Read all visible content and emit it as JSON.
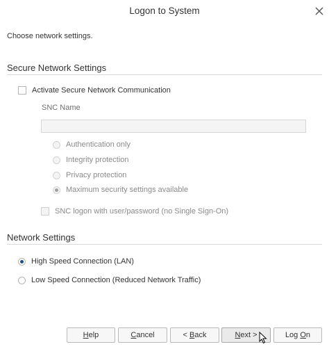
{
  "window": {
    "title": "Logon to System",
    "close_icon": "close-icon"
  },
  "intro_text": "Choose network settings.",
  "secure_network": {
    "section_title": "Secure Network Settings",
    "activate_snc": {
      "label": "Activate Secure Network Communication",
      "checked": false
    },
    "snc_name_label": "SNC Name",
    "snc_name_value": "",
    "protection_options": [
      {
        "label": "Authentication only",
        "selected": false
      },
      {
        "label": "Integrity protection",
        "selected": false
      },
      {
        "label": "Privacy protection",
        "selected": false
      },
      {
        "label": "Maximum security settings available",
        "selected": true
      }
    ],
    "snc_logon_password": {
      "label": "SNC logon with user/password (no Single Sign-On)",
      "checked": false
    }
  },
  "network_settings": {
    "section_title": "Network Settings",
    "options": [
      {
        "label": "High Speed Connection (LAN)",
        "selected": true
      },
      {
        "label": "Low Speed Connection (Reduced Network Traffic)",
        "selected": false
      }
    ]
  },
  "buttons": {
    "help": {
      "mnemonic": "H",
      "rest": "elp"
    },
    "cancel": {
      "mnemonic": "C",
      "rest": "ancel"
    },
    "back": {
      "pre": "< ",
      "mnemonic": "B",
      "rest": "ack"
    },
    "next": {
      "mnemonic": "N",
      "rest": "ext >"
    },
    "logon": {
      "pre": "Log ",
      "mnemonic": "O",
      "rest": "n"
    }
  },
  "colors": {
    "accent": "#1a4f8a",
    "border": "#b9b9b9",
    "disabled_text": "#8a8a8a"
  }
}
